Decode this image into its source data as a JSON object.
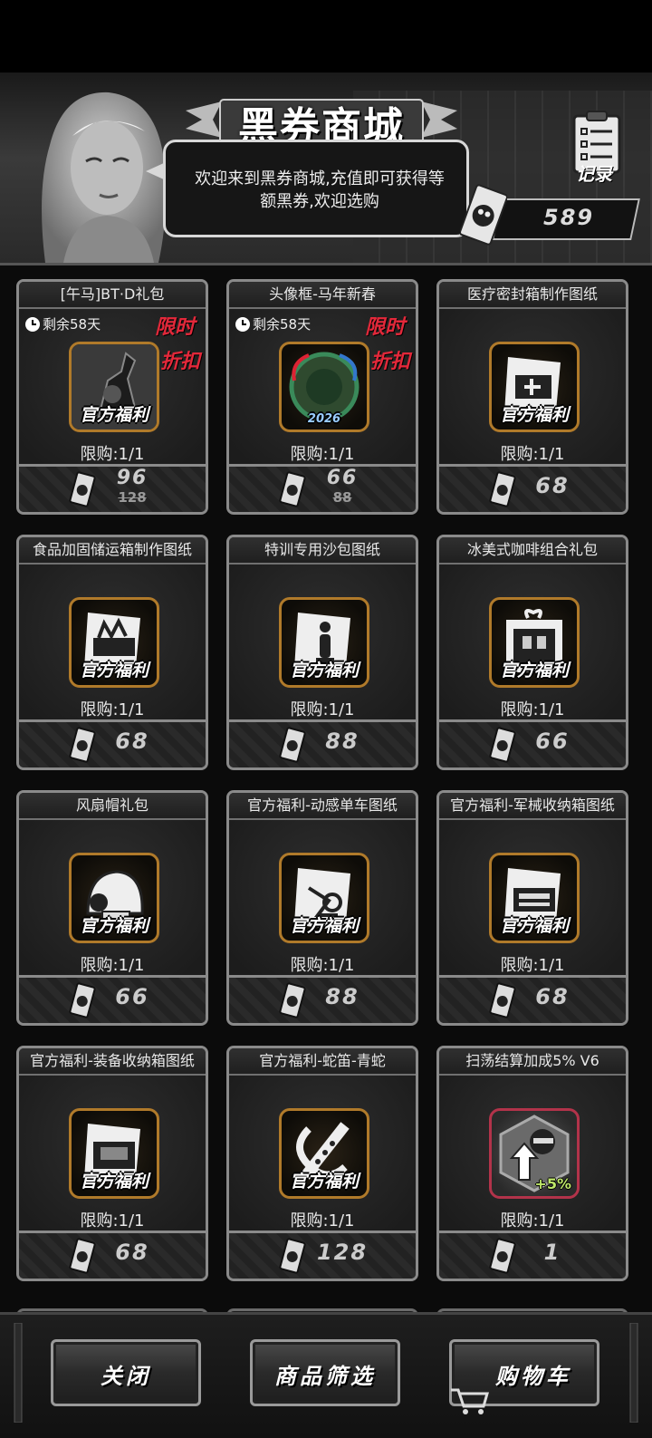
{
  "header": {
    "title": "黑券商城",
    "welcome": "欢迎来到黑券商城,充值即可获得等额黑券,欢迎选购",
    "record_label": "记录",
    "balance": "589"
  },
  "items": [
    {
      "name": "[午马]BT·D礼包",
      "timer": "剩余58天",
      "limited": "限时",
      "discount": "折扣",
      "welfare": "官方福利",
      "limit": "限购:1/1",
      "price": "96",
      "old_price": "128",
      "icon": "robot-scorpion-icon"
    },
    {
      "name": "头像框-马年新春",
      "timer": "剩余58天",
      "limited": "限时",
      "discount": "折扣",
      "welfare": "",
      "year": "2026",
      "limit": "限购:1/1",
      "price": "66",
      "old_price": "88",
      "icon": "avatar-frame-icon"
    },
    {
      "name": "医疗密封箱制作图纸",
      "welfare": "官方福利",
      "limit": "限购:1/1",
      "price": "68",
      "icon": "medical-box-blueprint-icon"
    },
    {
      "name": "食品加固储运箱制作图纸",
      "welfare": "官方福利",
      "limit": "限购:1/1",
      "price": "68",
      "icon": "food-crate-blueprint-icon"
    },
    {
      "name": "特训专用沙包图纸",
      "welfare": "官方福利",
      "limit": "限购:1/1",
      "price": "88",
      "icon": "sandbag-blueprint-icon"
    },
    {
      "name": "冰美式咖啡组合礼包",
      "welfare": "官方福利",
      "limit": "限购:1/1",
      "price": "66",
      "icon": "coffee-gift-icon"
    },
    {
      "name": "风扇帽礼包",
      "welfare": "官方福利",
      "limit": "限购:1/1",
      "price": "66",
      "icon": "fan-hat-icon"
    },
    {
      "name": "官方福利-动感单车图纸",
      "welfare": "官方福利",
      "limit": "限购:1/1",
      "price": "88",
      "icon": "bike-blueprint-icon"
    },
    {
      "name": "官方福利-军械收纳箱图纸",
      "welfare": "官方福利",
      "limit": "限购:1/1",
      "price": "68",
      "icon": "armory-box-blueprint-icon"
    },
    {
      "name": "官方福利-装备收纳箱图纸",
      "welfare": "官方福利",
      "limit": "限购:1/1",
      "price": "68",
      "icon": "gear-box-blueprint-icon"
    },
    {
      "name": "官方福利-蛇笛-青蛇",
      "welfare": "官方福利",
      "limit": "限购:1/1",
      "price": "128",
      "icon": "snake-flute-icon"
    },
    {
      "name": "扫荡结算加成5% V6",
      "welfare": "",
      "plus": "+5%",
      "limit": "限购:1/1",
      "price": "1",
      "icon": "sweep-bonus-icon"
    }
  ],
  "footer": {
    "close_label": "关闭",
    "filter_label": "商品筛选",
    "cart_label": "购物车"
  }
}
